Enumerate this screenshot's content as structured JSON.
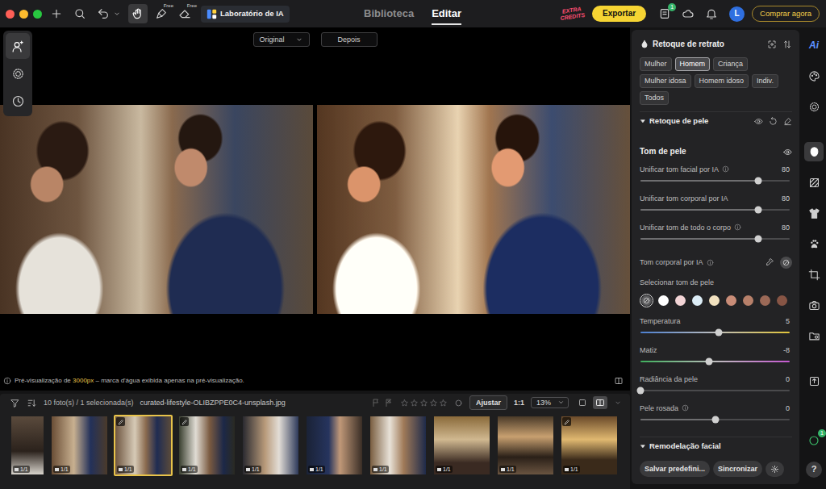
{
  "window": {
    "controls": [
      {
        "color": "#ff5f57"
      },
      {
        "color": "#febc2e"
      },
      {
        "color": "#28c840"
      }
    ]
  },
  "toolbar": {
    "tools": [
      {
        "kind": "plus",
        "selected": false
      },
      {
        "kind": "search",
        "selected": false
      },
      {
        "kind": "undo",
        "selected": false
      },
      {
        "kind": "hand",
        "selected": true
      },
      {
        "kind": "brush",
        "selected": false,
        "badge": "Free"
      },
      {
        "kind": "eraser",
        "selected": false,
        "badge": "Free"
      }
    ],
    "ai_lab": "Laboratório de IA",
    "tabs": [
      {
        "label": "Biblioteca",
        "selected": false
      },
      {
        "label": "Editar",
        "selected": true
      }
    ],
    "credits": [
      "EXTRA",
      "CREDITS"
    ],
    "export": "Exportar",
    "status_icons": [
      {
        "kind": "gift",
        "badge": "1"
      },
      {
        "kind": "cloud"
      },
      {
        "kind": "bell"
      }
    ],
    "avatar": "L",
    "buy": "Comprar agora"
  },
  "left_tools": [
    {
      "kind": "portrait",
      "selected": true
    },
    {
      "kind": "grain",
      "selected": false
    },
    {
      "kind": "history",
      "selected": false
    }
  ],
  "canvas": {
    "compare_mode": "Original",
    "after": "Depois",
    "note": {
      "prefix": "Pré-visualização de ",
      "highlight": "3000px",
      "suffix": " – marca d'água exibida apenas na pré-visualização."
    }
  },
  "filmstrip": {
    "count": "10 foto(s) / 1 selecionada(s)",
    "filename": "curated-lifestyle-OLIBZPPE0C4-unsplash.jpg",
    "flags": [
      {
        "kind": "pick",
        "selected": false
      },
      {
        "kind": "reject",
        "selected": false
      }
    ],
    "stars": 0,
    "fit": "Ajustar",
    "ratio": "1:1",
    "zoom": "13%",
    "views": [
      {
        "kind": "single",
        "selected": false
      },
      {
        "kind": "compare",
        "selected": true
      }
    ],
    "thumbs": [
      {
        "label": "1/1",
        "selected": false,
        "edited": false
      },
      {
        "label": "1/1",
        "selected": false,
        "edited": false
      },
      {
        "label": "1/1",
        "selected": true,
        "edited": true
      },
      {
        "label": "1/1",
        "selected": false,
        "edited": true
      },
      {
        "label": "1/1",
        "selected": false,
        "edited": false
      },
      {
        "label": "1/1",
        "selected": false,
        "edited": false
      },
      {
        "label": "1/1",
        "selected": false,
        "edited": false
      },
      {
        "label": "1/1",
        "selected": false,
        "edited": false
      },
      {
        "label": "1/1",
        "selected": false,
        "edited": false
      },
      {
        "label": "1/1",
        "selected": false,
        "edited": true
      }
    ]
  },
  "panel": {
    "title": "Retoque de retrato",
    "presets": [
      {
        "label": "Mulher",
        "selected": false
      },
      {
        "label": "Homem",
        "selected": true
      },
      {
        "label": "Criança",
        "selected": false
      },
      {
        "label": "Mulher idosa",
        "selected": false
      },
      {
        "label": "Homem idoso",
        "selected": false
      },
      {
        "label": "Indiv.",
        "selected": false
      },
      {
        "label": "Todos",
        "selected": false
      }
    ],
    "skin_section": {
      "label": "Retoque de pele",
      "expanded": true
    },
    "skin_tone": {
      "title": "Tom de pele"
    },
    "sliders": [
      {
        "label": "Unificar tom facial por IA",
        "info": true,
        "value": "80",
        "level": 0.79,
        "kind": "plain"
      },
      {
        "label": "Unificar tom corporal por IA",
        "info": false,
        "value": "80",
        "level": 0.79,
        "kind": "plain"
      },
      {
        "label": "Unificar tom de todo o corpo",
        "info": true,
        "value": "80",
        "level": 0.79,
        "kind": "plain"
      }
    ],
    "body_tone": {
      "label": "Tom corporal por IA",
      "info": true
    },
    "swatch_title": "Selecionar tom de pele",
    "swatches": [
      {
        "kind": "none",
        "color": "#5a5a5c",
        "selected": true
      },
      {
        "kind": "color",
        "color": "#ffffff",
        "selected": false
      },
      {
        "kind": "color",
        "color": "#f3d5d7",
        "selected": false
      },
      {
        "kind": "color",
        "color": "#dcedf6",
        "selected": false
      },
      {
        "kind": "color",
        "color": "#f2e2c0",
        "selected": false
      },
      {
        "kind": "color",
        "color": "#c98d78",
        "selected": false
      },
      {
        "kind": "color",
        "color": "#b7806a",
        "selected": false
      },
      {
        "kind": "color",
        "color": "#9b6957",
        "selected": false
      },
      {
        "kind": "color",
        "color": "#875545",
        "selected": false
      }
    ],
    "color_sliders": [
      {
        "label": "Temperatura",
        "info": false,
        "value": "5",
        "level": 0.525,
        "kind": "temperature"
      },
      {
        "label": "Matiz",
        "info": false,
        "value": "-8",
        "level": 0.46,
        "kind": "tint"
      },
      {
        "label": "Radiância da pele",
        "info": false,
        "value": "0",
        "level": 0,
        "kind": "plain"
      },
      {
        "label": "Pele rosada",
        "info": true,
        "value": "0",
        "level": 0.5,
        "kind": "plain"
      }
    ],
    "reshape_section": {
      "label": "Remodelação facial",
      "expanded": true
    },
    "save": "Salvar predefini...",
    "sync": "Sincronizar"
  },
  "rail": {
    "items": [
      {
        "kind": "ai",
        "label": "Ai",
        "selected": false
      },
      {
        "kind": "palette",
        "selected": false
      },
      {
        "kind": "grain",
        "selected": false
      },
      {
        "kind": "face",
        "selected": true
      },
      {
        "kind": "texture",
        "selected": false
      },
      {
        "kind": "shirt",
        "selected": false
      },
      {
        "kind": "paw",
        "selected": false
      },
      {
        "kind": "crop",
        "selected": false
      },
      {
        "kind": "camera",
        "selected": false
      },
      {
        "kind": "folder",
        "selected": false
      },
      {
        "kind": "sticker",
        "selected": false
      }
    ],
    "tasks_badge": "1",
    "help": "?"
  }
}
